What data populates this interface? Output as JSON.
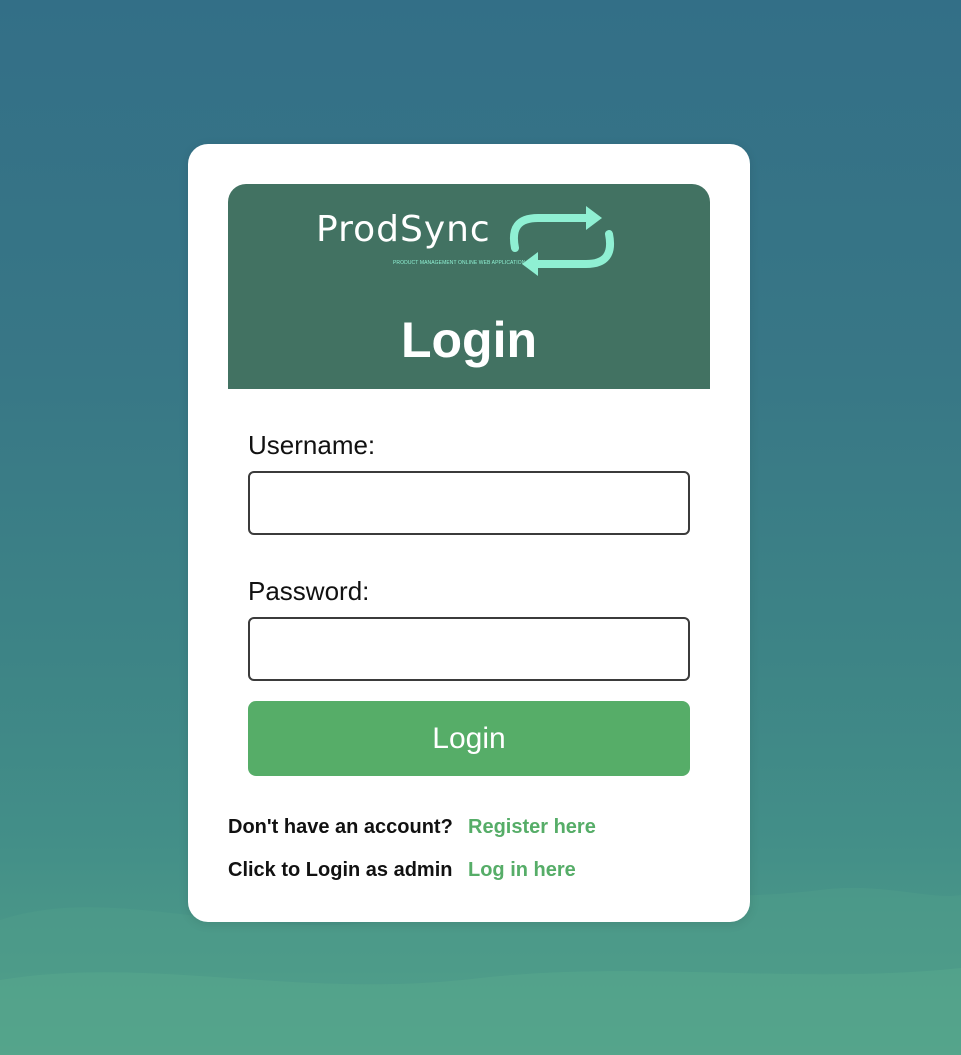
{
  "brand": {
    "name": "ProdSync",
    "tagline": "PRODUCT MANAGEMENT ONLINE WEB APPLICATION",
    "logo_icon": "sync-arrows-icon"
  },
  "login_form": {
    "title": "Login",
    "username_label": "Username:",
    "username_value": "",
    "password_label": "Password:",
    "password_value": "",
    "submit_label": "Login"
  },
  "footer": {
    "register_prompt": "Don't have an account?",
    "register_link": "Register here",
    "admin_prompt": "Click to Login as admin",
    "admin_link": "Log in here"
  },
  "colors": {
    "header_bg": "#427262",
    "accent_green": "#56ad68",
    "logo_arrow": "#8ff0d3",
    "card_bg": "#ffffff"
  }
}
